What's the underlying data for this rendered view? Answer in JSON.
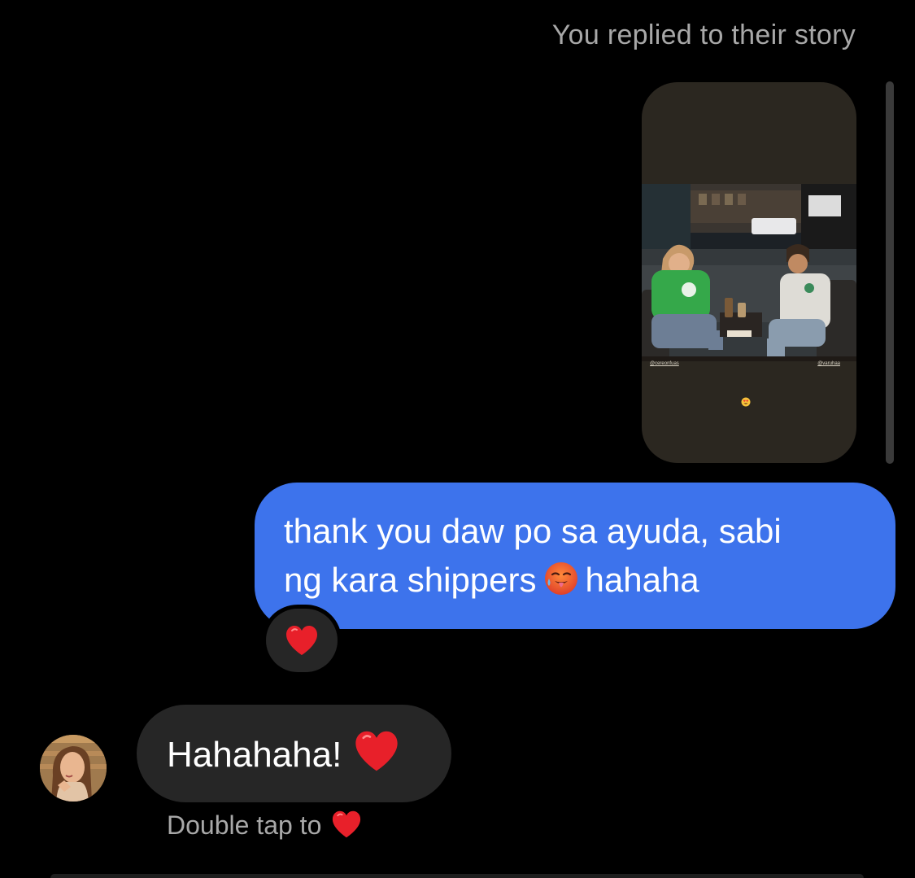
{
  "thread": {
    "reply_note": "You replied to their story",
    "story": {
      "tag_left": "@cereonfuas",
      "tag_right": "@varuhaa",
      "sticker_icon": "heart-eyes-emoji",
      "background": "#2b2720"
    },
    "sent_message": {
      "line1": "thank you daw po sa ayuda, sabi",
      "line2_text": "ng kara shippers",
      "emoji": "🥵",
      "emoji_icon": "hot-face-emoji",
      "line2_suffix": "hahaha",
      "bubble_color": "#3d73ec"
    },
    "reaction": {
      "icon": "red-heart-emoji",
      "color": "#e8202a"
    },
    "received_message": {
      "text": "Hahahaha!",
      "emoji_icon": "red-heart-emoji",
      "bubble_color": "#262626"
    },
    "hint": {
      "text": "Double tap to",
      "icon": "red-heart-emoji"
    }
  }
}
